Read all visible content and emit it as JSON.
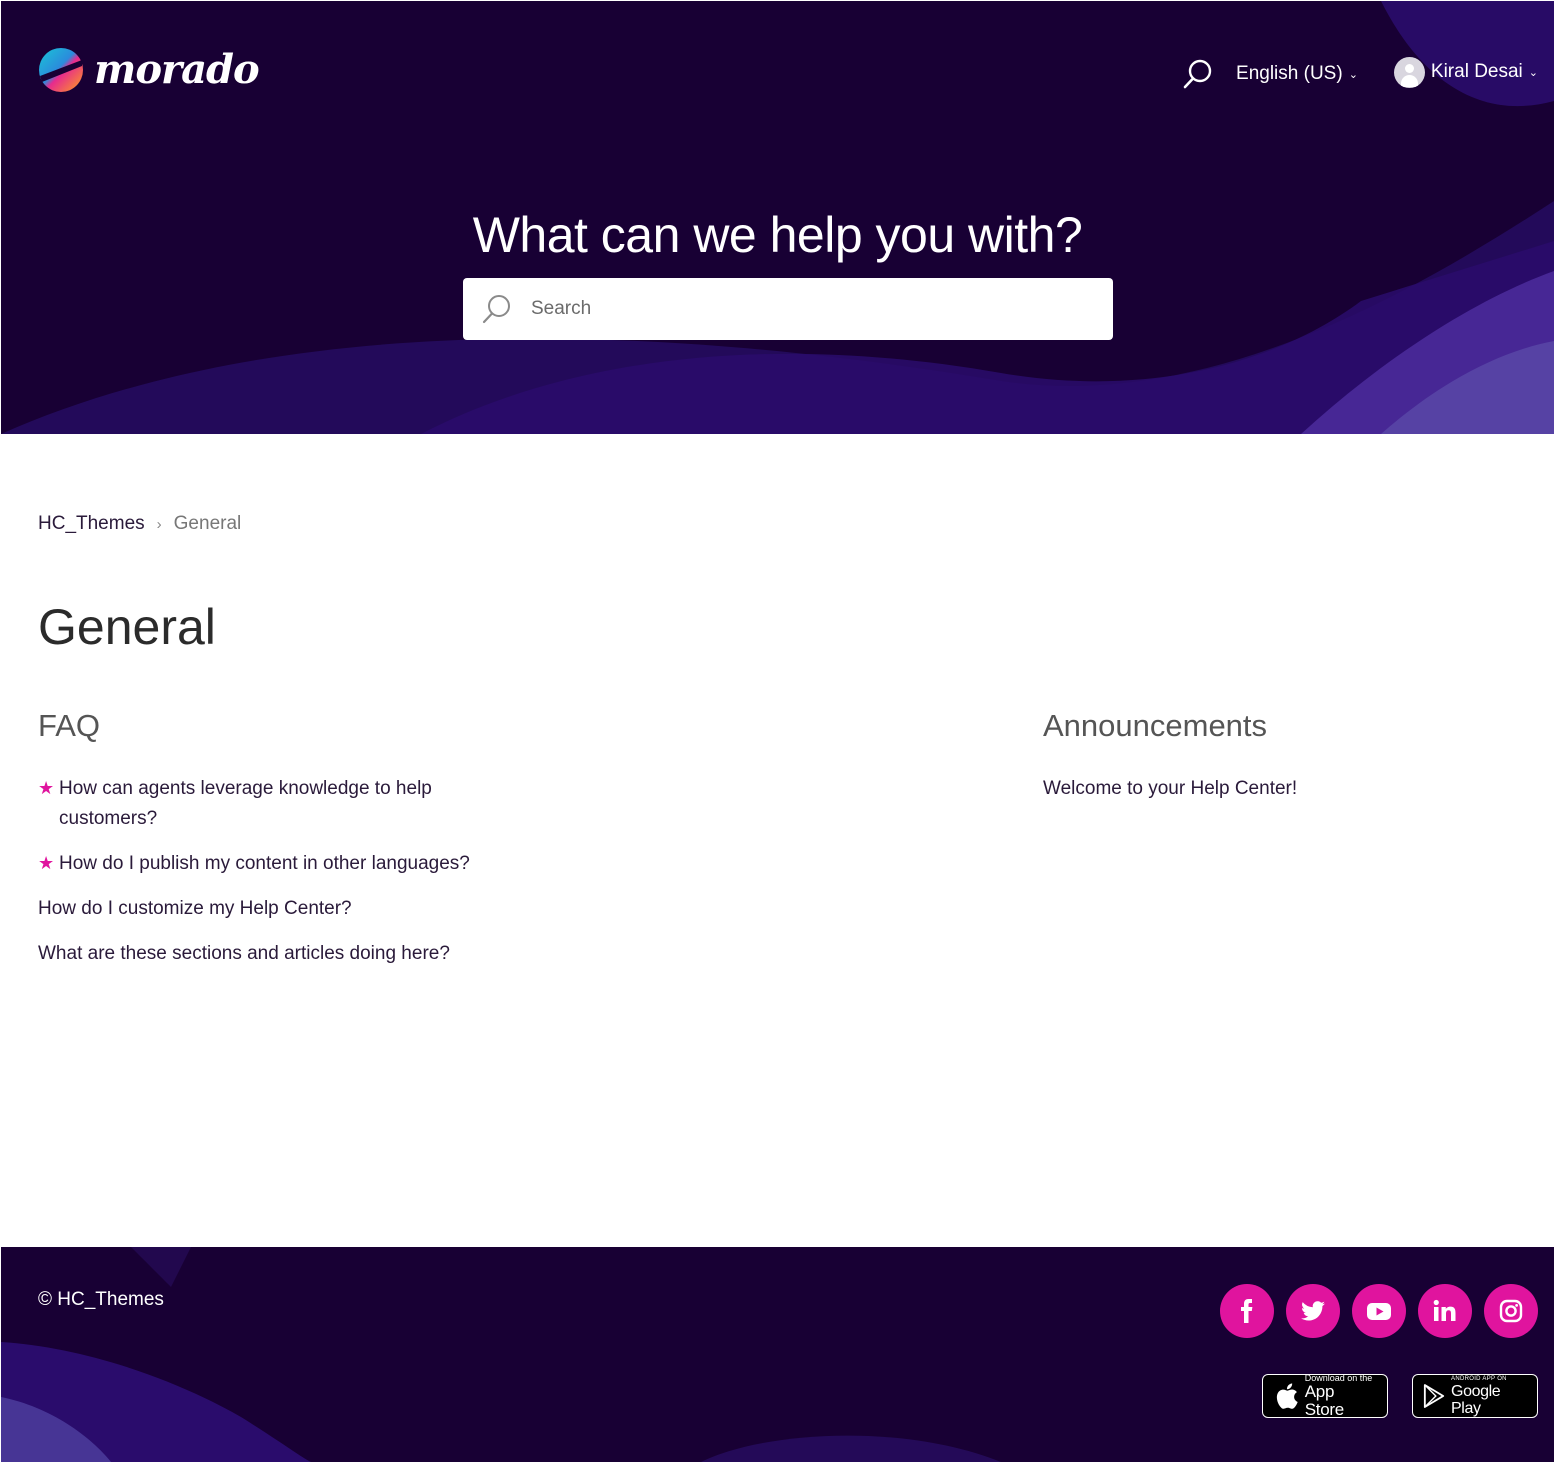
{
  "brand": {
    "name": "morado"
  },
  "header": {
    "language": "English (US)",
    "user_name": "Kiral Desai"
  },
  "hero": {
    "title": "What can we help you with?",
    "search_placeholder": "Search"
  },
  "breadcrumb": {
    "root": "HC_Themes",
    "current": "General"
  },
  "page": {
    "title": "General"
  },
  "sections": {
    "faq": {
      "title": "FAQ",
      "articles": [
        {
          "title": "How can agents leverage knowledge to help customers?",
          "promoted": true
        },
        {
          "title": "How do I publish my content in other languages?",
          "promoted": true
        },
        {
          "title": "How do I customize my Help Center?",
          "promoted": false
        },
        {
          "title": "What are these sections and articles doing here?",
          "promoted": false
        }
      ]
    },
    "announcements": {
      "title": "Announcements",
      "articles": [
        {
          "title": "Welcome to your Help Center!",
          "promoted": false
        }
      ]
    }
  },
  "footer": {
    "copyright": "© HC_Themes",
    "social": [
      "facebook-icon",
      "twitter-icon",
      "youtube-icon",
      "linkedin-icon",
      "instagram-icon"
    ],
    "app_store": {
      "small": "Download on the",
      "big": "App Store"
    },
    "google_play": {
      "small": "ANDROID APP ON",
      "big": "Google Play"
    }
  },
  "colors": {
    "hero_bg": "#180034",
    "accent": "#e0149e",
    "wave": "#2a0a6e"
  }
}
